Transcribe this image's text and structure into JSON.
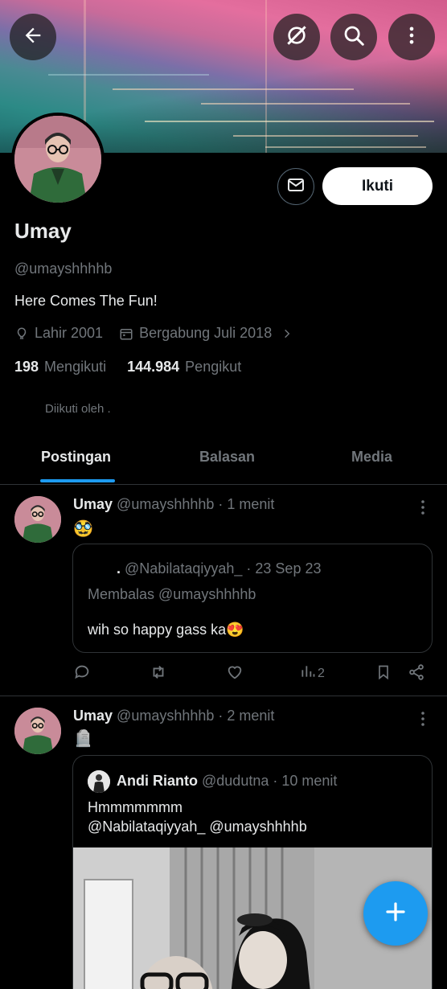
{
  "colors": {
    "accent": "#1d9bf0",
    "text": "#e7e9ea",
    "muted": "#71767b",
    "border": "#2f3336",
    "background": "#000000"
  },
  "topbar": {
    "back_icon": "arrow-left-icon",
    "grok_icon": "grok-icon",
    "search_icon": "search-icon",
    "more_icon": "more-vertical-icon"
  },
  "profile": {
    "name": "Umay",
    "handle": "@umayshhhhb",
    "bio": "Here Comes The Fun!",
    "born": "Lahir 2001",
    "joined": "Bergabung Juli 2018",
    "following_count": "198",
    "following_label": "Mengikuti",
    "followers_count": "144.984",
    "followers_label": "Pengikut",
    "followed_by": "Diikuti oleh ."
  },
  "actions": {
    "follow_label": "Ikuti",
    "message_icon": "mail-icon"
  },
  "tabs": [
    {
      "label": "Postingan",
      "active": true
    },
    {
      "label": "Balasan",
      "active": false
    },
    {
      "label": "Media",
      "active": false
    }
  ],
  "posts": [
    {
      "name": "Umay",
      "handle": "@umayshhhhb",
      "time": "· 1 menit",
      "text": "🥸",
      "quote": {
        "name_dot": ".",
        "handle": "@Nabilataqiyyah_",
        "time": "· 23 Sep 23",
        "reply_to": "Membalas @umayshhhhb",
        "text": "wih so happy gass ka😍"
      },
      "views": "2"
    },
    {
      "name": "Umay",
      "handle": "@umayshhhhb",
      "time": "· 2 menit",
      "text": "🪦",
      "quote": {
        "name": "Andi Rianto",
        "handle": "@dudutna",
        "time": "· 10 menit",
        "line1": "Hmmmmmmm",
        "line2": "@Nabilataqiyyah_ @umayshhhhb"
      }
    }
  ],
  "fab": {
    "icon": "plus-icon"
  }
}
